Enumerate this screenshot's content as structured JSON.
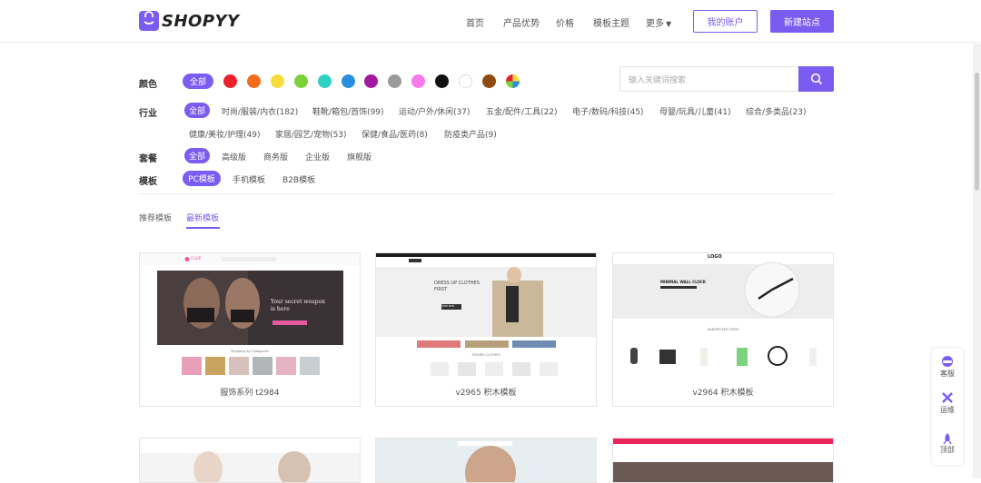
{
  "brand": {
    "name": "SHOPYY",
    "accent": "#7b5cf0"
  },
  "nav": {
    "home": "首页",
    "features": "产品优势",
    "pricing": "价格",
    "themes": "模板主题",
    "more": "更多",
    "my_account": "我的账户",
    "new_site": "新建站点"
  },
  "filters": {
    "color_label": "颜色",
    "color_all": "全部",
    "colors": [
      "#e8212a",
      "#f26b1d",
      "#f7dd3b",
      "#7cd13a",
      "#2ed1c4",
      "#2a8fe0",
      "#a01a9e",
      "#9a9a9a",
      "#f67ae8",
      "#111111",
      "#ffffff",
      "#8f4a12",
      "multi"
    ],
    "search_placeholder": "输入关键词搜索",
    "industry_label": "行业",
    "industry_all": "全部",
    "industries_row1": [
      "时尚/服装/内衣(182)",
      "鞋靴/箱包/首饰(99)",
      "运动/户外/休闲(37)",
      "五金/配件/工具(22)",
      "电子/数码/科技(45)",
      "母婴/玩具/儿童(41)",
      "综合/多类品(23)"
    ],
    "industries_row2": [
      "健康/美妆/护理(49)",
      "家居/园艺/宠物(53)",
      "保健/食品/医药(8)",
      "防疫类产品(9)"
    ],
    "plan_label": "套餐",
    "plan_all": "全部",
    "plans": [
      "高级版",
      "商务版",
      "企业版",
      "旗舰版"
    ],
    "template_label": "模板",
    "templates": [
      "PC模板",
      "手机模板",
      "B2B模板"
    ]
  },
  "tabs": {
    "recommended": "推荐模板",
    "latest": "最新模板"
  },
  "cards": [
    {
      "caption": "服饰系列 t2984",
      "hero": "Your secret weapon is here",
      "section": "Shopping by Categories",
      "logo": "CUUP"
    },
    {
      "caption": "v2965 积木模板",
      "hero": "DRESS UP CLOTHES FIRST",
      "cta": "SHOP NOW",
      "section": "TRENDY CLOTHES"
    },
    {
      "caption": "v2964 积木模板",
      "hero": "MINIMAL WALL CLOCK",
      "logo": "LOGO",
      "section": "HANDPICKED ITEMS"
    }
  ],
  "side_panel": {
    "service": "客服",
    "ops": "运维",
    "top": "顶部"
  }
}
